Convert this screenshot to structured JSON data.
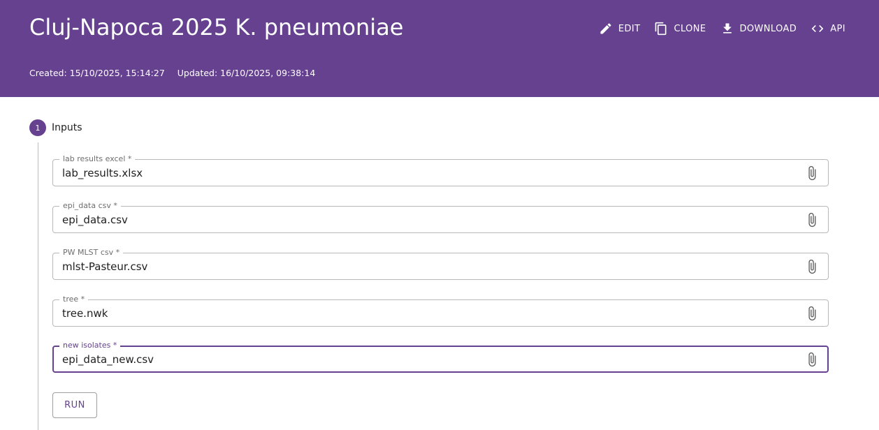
{
  "header": {
    "title": "Cluj-Napoca 2025 K. pneumoniae",
    "created": "Created: 15/10/2025, 15:14:27",
    "updated": "Updated: 16/10/2025, 09:38:14",
    "bg_color": "#65418f"
  },
  "toolbar": {
    "edit_label": "EDIT",
    "clone_label": "CLONE",
    "download_label": "DOWNLOAD",
    "api_label": "API"
  },
  "step": {
    "number": "1",
    "label": "Inputs"
  },
  "inputs": [
    {
      "label": "lab results excel *",
      "value": "lab_results.xlsx"
    },
    {
      "label": "epi_data csv *",
      "value": "epi_data.csv"
    },
    {
      "label": "PW MLST csv *",
      "value": "mlst-Pasteur.csv"
    },
    {
      "label": "tree *",
      "value": "tree.nwk"
    },
    {
      "label": "new isolates *",
      "value": "epi_data_new.csv",
      "focused": true
    }
  ],
  "run_label": "RUN",
  "icons": {
    "edit": "pencil-icon",
    "clone": "copy-icon",
    "download": "download-icon",
    "api": "code-icon",
    "attach": "paperclip-icon"
  }
}
